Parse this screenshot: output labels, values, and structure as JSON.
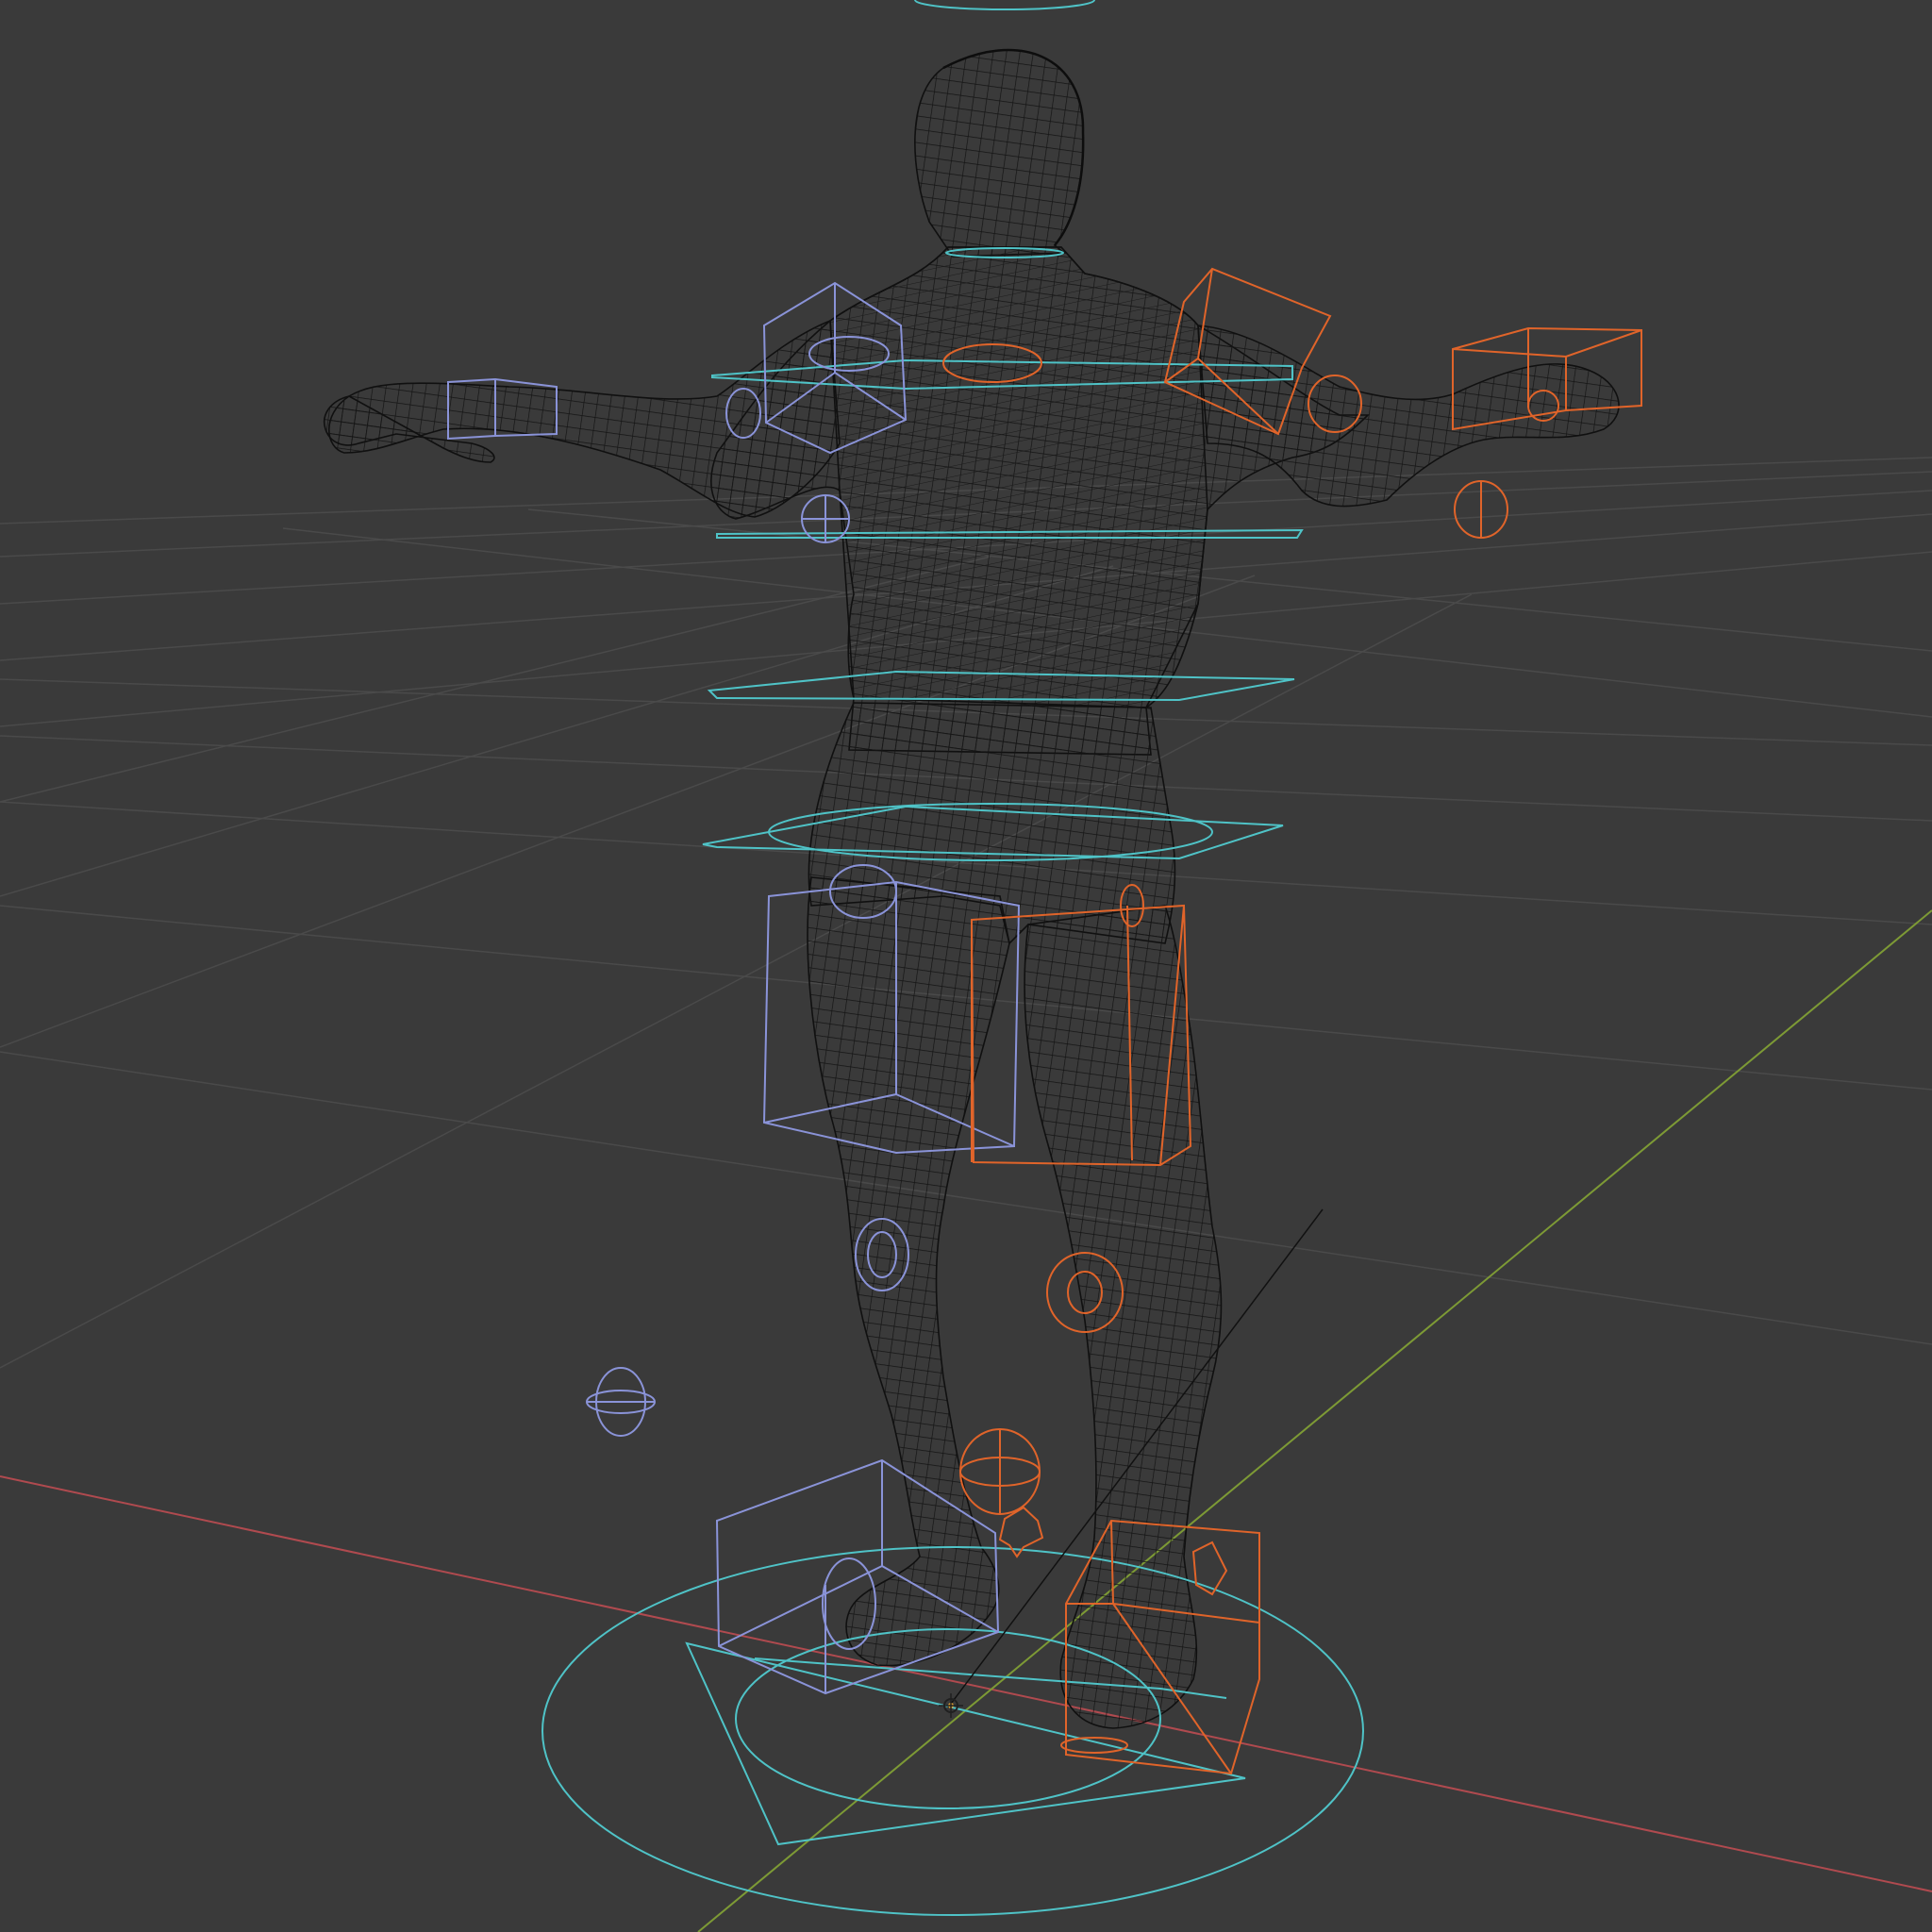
{
  "viewport": {
    "kind": "3d-viewport",
    "shading": "wireframe",
    "background": "#3a3a3a"
  },
  "colors": {
    "grid": "#4a4a4a",
    "x_axis": "#b04a4f",
    "y_axis": "#7d9a35",
    "mesh": "#161616",
    "control_center": "#4fc3c7",
    "control_left": "#8a93d8",
    "control_right": "#e0642a"
  },
  "scene": {
    "objects": [
      {
        "name": "character-mesh",
        "type": "mesh-wireframe"
      },
      {
        "name": "armature-controls",
        "type": "rig-controls"
      },
      {
        "name": "origin-marker",
        "type": "empty"
      }
    ]
  }
}
